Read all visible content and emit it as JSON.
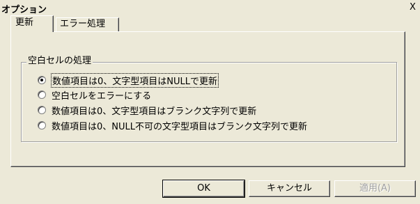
{
  "window": {
    "title": "オプション",
    "close_glyph": "X"
  },
  "tabs": [
    {
      "label": "更新",
      "active": true
    },
    {
      "label": "エラー処理",
      "active": false
    }
  ],
  "group": {
    "legend": "空白セルの処理",
    "options": [
      {
        "label": "数値項目は0、文字型項目はNULLで更新",
        "checked": true
      },
      {
        "label": "空白セルをエラーにする",
        "checked": false
      },
      {
        "label": "数値項目は0、文字型項目はブランク文字列で更新",
        "checked": false
      },
      {
        "label": "数値項目は0、NULL不可の文字型項目はブランク文字列で更新",
        "checked": false
      }
    ]
  },
  "buttons": {
    "ok_label": "OK",
    "cancel_label": "キャンセル",
    "apply_label": "適用(A)",
    "apply_enabled": false
  }
}
